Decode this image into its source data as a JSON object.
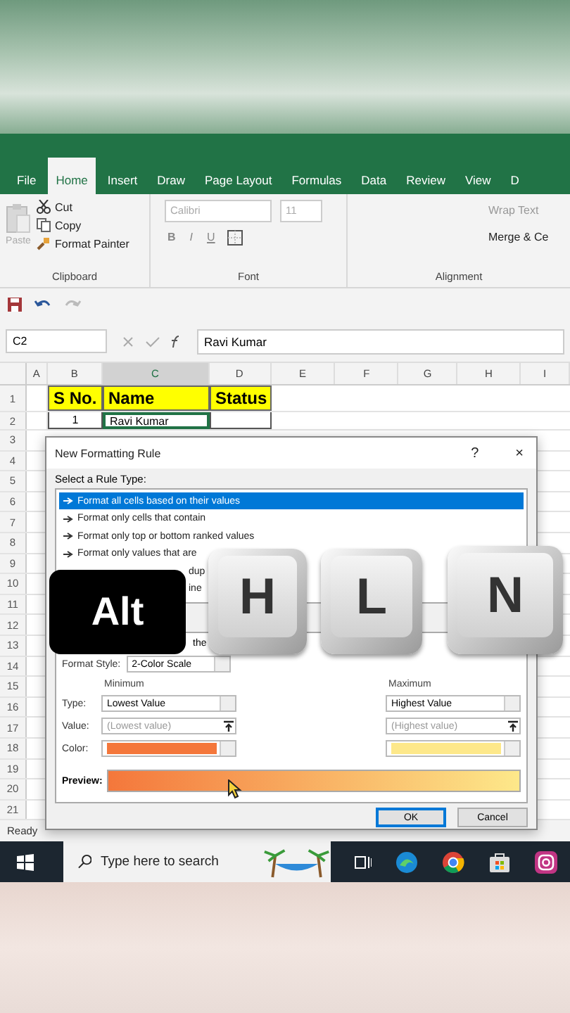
{
  "ribbon_tabs": [
    {
      "label": "File",
      "selected": false
    },
    {
      "label": "Home",
      "selected": true
    },
    {
      "label": "Insert",
      "selected": false
    },
    {
      "label": "Draw",
      "selected": false
    },
    {
      "label": "Page Layout",
      "selected": false
    },
    {
      "label": "Formulas",
      "selected": false
    },
    {
      "label": "Data",
      "selected": false
    },
    {
      "label": "Review",
      "selected": false
    },
    {
      "label": "View",
      "selected": false
    },
    {
      "label": "D",
      "selected": false
    }
  ],
  "clipboard": {
    "paste": "Paste",
    "items": [
      "Cut",
      "Copy",
      "Format Painter"
    ],
    "group": "Clipboard"
  },
  "font": {
    "name": "Calibri",
    "size": "11",
    "styles": [
      "B",
      "I",
      "U"
    ],
    "group": "Font"
  },
  "alignment": {
    "wrap": "Wrap Text",
    "merge": "Merge & Ce",
    "group": "Alignment"
  },
  "name_box": "C2",
  "formula": "Ravi Kumar",
  "columns": [
    {
      "label": "A",
      "selected": false
    },
    {
      "label": "B",
      "selected": false
    },
    {
      "label": "C",
      "selected": true
    },
    {
      "label": "D",
      "selected": false
    },
    {
      "label": "E",
      "selected": false
    },
    {
      "label": "F",
      "selected": false
    },
    {
      "label": "G",
      "selected": false
    },
    {
      "label": "H",
      "selected": false
    },
    {
      "label": "I",
      "selected": false
    }
  ],
  "rows": [
    {
      "number": "1",
      "kind": "header",
      "b": "S No.",
      "c": "Name",
      "d": "Status"
    },
    {
      "number": "2",
      "kind": "data",
      "b": "1",
      "c": "Ravi Kumar"
    }
  ],
  "more_row_numbers": [
    "3",
    "4",
    "5",
    "6",
    "7",
    "8",
    "9",
    "10",
    "11",
    "12",
    "13",
    "14",
    "15",
    "16",
    "17",
    "18",
    "19",
    "20",
    "21"
  ],
  "dialog": {
    "title": "New Formatting Rule",
    "help": "?",
    "close": "×",
    "rule_type_label": "Select a Rule Type:",
    "rule_types": [
      {
        "label": "Format all cells based on their values",
        "selected": true,
        "kind": "full"
      },
      {
        "label": "Format only cells that contain",
        "selected": false,
        "kind": "full"
      },
      {
        "label": "Format only top or bottom ranked values",
        "selected": false,
        "kind": "full"
      },
      {
        "label": "Format only values that are",
        "selected": false,
        "kind": "full"
      },
      {
        "label": "dup",
        "selected": false,
        "kind": "covered"
      },
      {
        "label": "ine",
        "selected": false,
        "kind": "covered"
      }
    ],
    "description_heading": "the",
    "format_style_label": "Format Style:",
    "format_style": "2-Color Scale",
    "type_label": "Type:",
    "value_label": "Value:",
    "color_label": "Color:",
    "minimum": {
      "heading": "Minimum",
      "type": "Lowest Value",
      "value_placeholder": "(Lowest value)",
      "color": "#f4773b"
    },
    "maximum": {
      "heading": "Maximum",
      "type": "Highest Value",
      "value_placeholder": "(Highest value)",
      "color": "#fde88a"
    },
    "preview_label": "Preview:",
    "buttons": [
      {
        "label": "OK",
        "kind": "default"
      },
      {
        "label": "Cancel",
        "kind": "normal"
      }
    ]
  },
  "status": "Ready",
  "taskbar": {
    "search_placeholder": "Type here to search"
  },
  "key_overlay": [
    {
      "label": "Alt",
      "kind": "dark"
    },
    {
      "label": "H",
      "kind": "light"
    },
    {
      "label": "L",
      "kind": "light"
    },
    {
      "label": "N",
      "kind": "light"
    }
  ]
}
